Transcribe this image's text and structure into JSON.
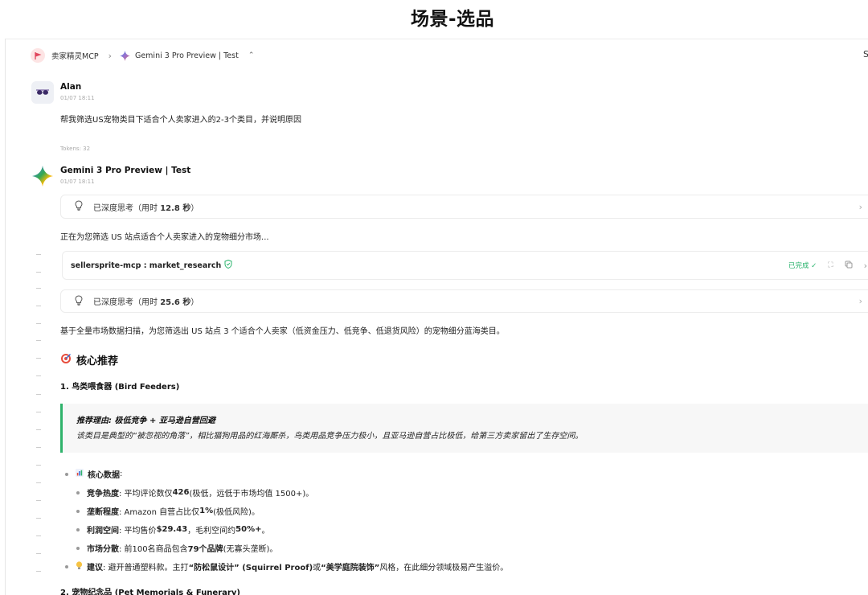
{
  "page_title": "场景-选品",
  "breadcrumb": {
    "app": "卖家精灵MCP",
    "model": "Gemini 3 Pro Preview | Test"
  },
  "edge_letter": "S",
  "user_msg": {
    "name": "Alan",
    "time": "01/07 18:11",
    "text": "帮我筛选US宠物类目下适合个人卖家进入的2-3个类目，并说明原因",
    "tokens": "Tokens: 32"
  },
  "bot_msg": {
    "name": "Gemini 3 Pro Preview | Test",
    "time": "01/07 18:11",
    "think1_prefix": "已深度思考（用时",
    "think1_value": "12.8 秒",
    "think1_suffix": "）",
    "progress_text": "正在为您筛选 US 站点适合个人卖家进入的宠物细分市场...",
    "tool_name": "sellersprite-mcp : market_research",
    "tool_status": "已完成",
    "think2_prefix": "已深度思考（用时",
    "think2_value": "25.6 秒",
    "think2_suffix": "）",
    "intro": "基于全量市场数据扫描，为您筛选出 US 站点 3 个适合个人卖家（低资金压力、低竞争、低退货风险）的宠物细分蓝海类目。",
    "section_title": "核心推荐",
    "item1_title": "1. 鸟类喂食器 (Bird Feeders)",
    "quote_title": "推荐理由: 极低竞争 + 亚马逊自营回避",
    "quote_body": "该类目是典型的“被忽视的角落”，相比猫狗用品的红海厮杀，鸟类用品竞争压力极小，且亚马逊自营占比极低，给第三方卖家留出了生存空间。",
    "core_data_label": "核心数据",
    "bullets": [
      {
        "k": "竞争热度",
        "pre": ": 平均评论数仅 ",
        "v": "426",
        "post": " (极低，远低于市场均值 1500+)。"
      },
      {
        "k": "垄断程度",
        "pre": ": Amazon 自营占比仅 ",
        "v": "1%",
        "post": " (极低风险)。"
      },
      {
        "k": "利润空间",
        "pre": ": 平均售价 ",
        "v": "$29.43",
        "mid": "，毛利空间约 ",
        "v2": "50%+",
        "post": "。"
      },
      {
        "k": "市场分散",
        "pre": ": 前100名商品包含 ",
        "v": "79个品牌",
        "post": " (无寡头垄断)。"
      }
    ],
    "advice_label": "建议",
    "advice_pre": ": 避开普通塑料款。主打 ",
    "advice_b1": "“防松鼠设计” (Squirrel Proof)",
    "advice_mid": " 或 ",
    "advice_b2": "“美学庭院装饰”",
    "advice_post": " 风格，在此细分领域极易产生溢价。",
    "item2_title": "2. 宠物纪念品 (Pet Memorials & Funerary)"
  }
}
